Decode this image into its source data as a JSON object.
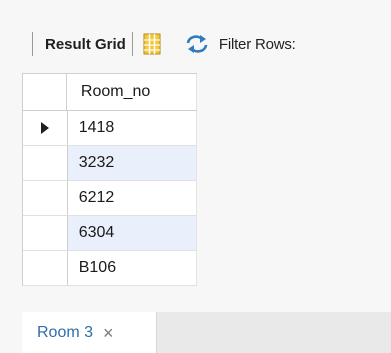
{
  "toolbar": {
    "result_grid_label": "Result Grid",
    "filter_rows_label": "Filter Rows:"
  },
  "grid": {
    "columns": [
      "Room_no"
    ],
    "rows": [
      {
        "room_no": "1418",
        "selected": true
      },
      {
        "room_no": "3232"
      },
      {
        "room_no": "6212"
      },
      {
        "room_no": "6304"
      },
      {
        "room_no": "B106"
      }
    ]
  },
  "tabs": [
    {
      "label": "Room 3",
      "close": "×"
    }
  ],
  "colors": {
    "tab_label": "#2f6ea8",
    "alt_row": "#e9f0fb",
    "grid_icon": "#e8b923",
    "refresh_icon": "#2e7bbf"
  },
  "icons": [
    "grid-view-icon",
    "refresh-icon",
    "row-pointer-icon",
    "close-icon"
  ]
}
